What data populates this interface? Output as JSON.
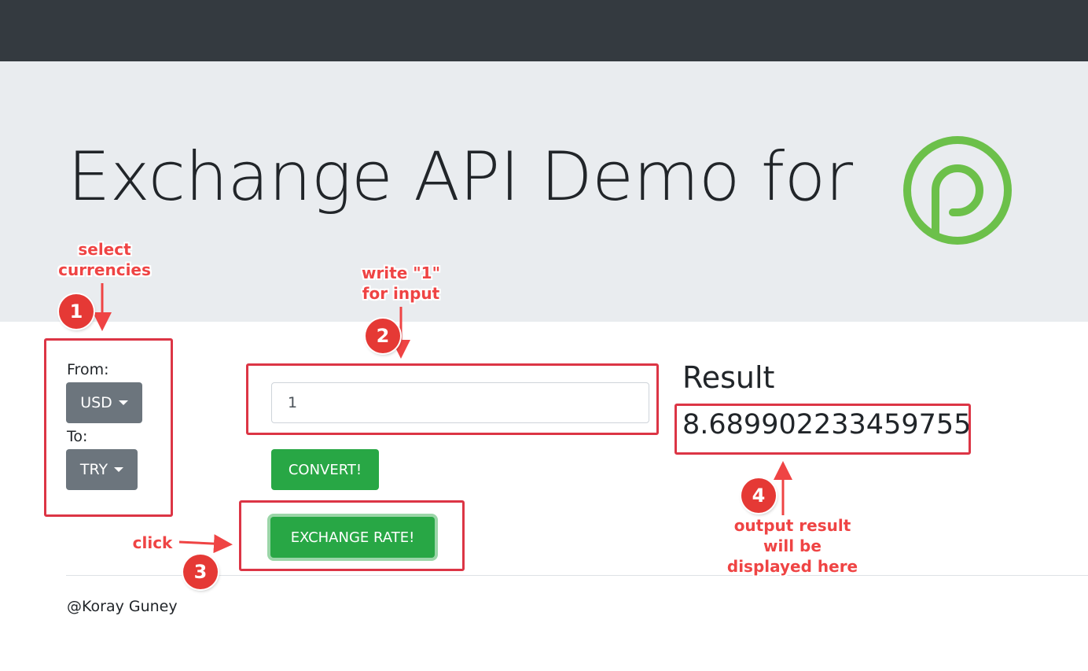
{
  "header": {
    "title": "Exchange API Demo for"
  },
  "form": {
    "from_label": "From:",
    "from_value": "USD",
    "to_label": "To:",
    "to_value": "TRY",
    "amount_value": "1",
    "convert_label": "CONVERT!",
    "exchange_rate_label": "EXCHANGE RATE!"
  },
  "result": {
    "heading": "Result",
    "value": "8.689902233459755"
  },
  "footer": {
    "text": "@Koray Guney"
  },
  "annotations": {
    "step1_number": "1",
    "step1_text": "select\ncurrencies",
    "step2_number": "2",
    "step2_text": "write \"1\"\nfor input",
    "step3_number": "3",
    "step3_text": "click",
    "step4_number": "4",
    "step4_text": "output result\nwill be\ndisplayed here"
  },
  "colors": {
    "navbar": "#343a40",
    "jumbotron": "#e9ecef",
    "success": "#28a745",
    "secondary": "#6c757d",
    "annotation": "#dc3545",
    "logo": "#6cc04a"
  },
  "icons": {
    "logo": "green-p-logo-icon",
    "caret": "caret-down-icon"
  }
}
